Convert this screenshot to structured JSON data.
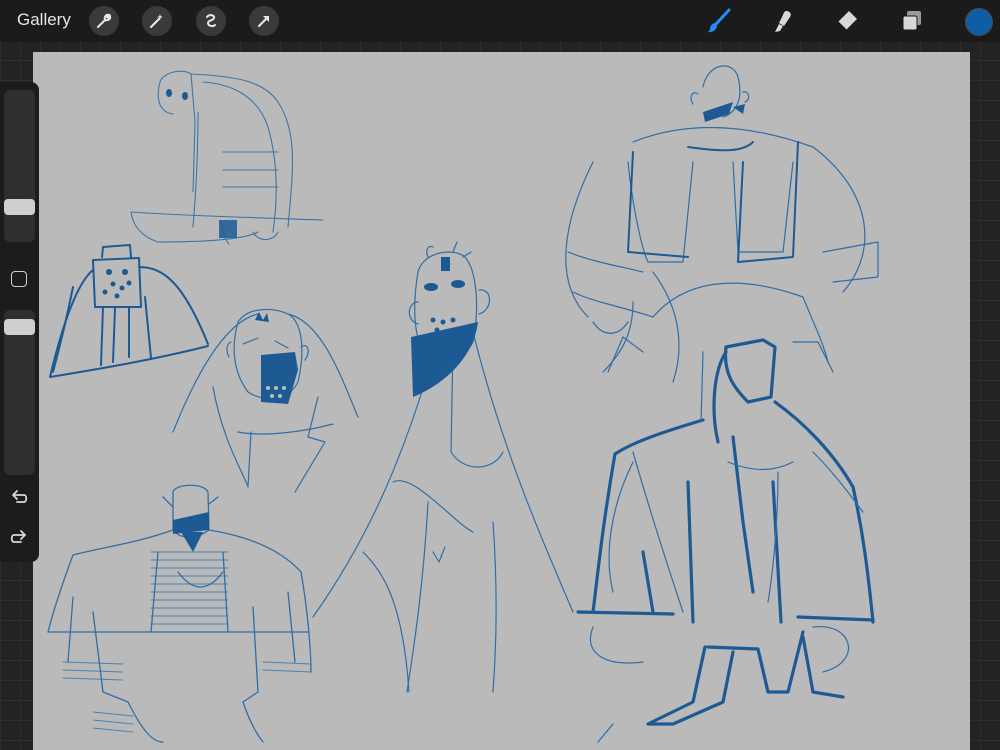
{
  "topbar": {
    "gallery_label": "Gallery",
    "left_tools": [
      {
        "icon": "wrench-icon"
      },
      {
        "icon": "magic-wand-icon"
      },
      {
        "icon": "selection-icon"
      },
      {
        "icon": "transform-arrow-icon"
      }
    ],
    "right_tools": [
      {
        "icon": "brush-icon"
      },
      {
        "icon": "smudge-icon"
      },
      {
        "icon": "eraser-icon"
      },
      {
        "icon": "layers-icon"
      }
    ],
    "current_color": "#0d5ea3"
  },
  "sidebar": {
    "brush_size_icon": "brush-size-slider",
    "modify_icon": "square-icon",
    "opacity_icon": "opacity-slider",
    "undo_icon": "undo-icon",
    "redo_icon": "redo-icon"
  },
  "canvas": {
    "background": "#bababa",
    "ink_color": "#0d5ea3"
  }
}
